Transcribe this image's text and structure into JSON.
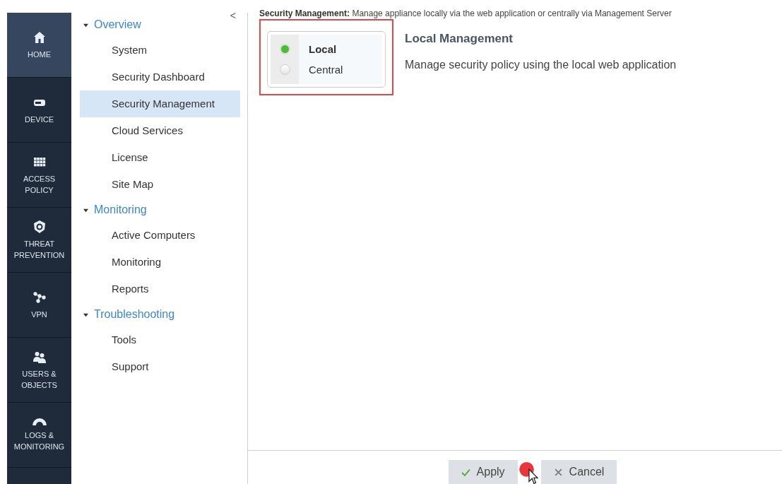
{
  "sidebar": {
    "items": [
      {
        "kind": "home",
        "label": "HOME",
        "selected": true
      },
      {
        "kind": "device",
        "label": "DEVICE",
        "selected": false
      },
      {
        "kind": "grid",
        "label": "ACCESS POLICY",
        "selected": false
      },
      {
        "kind": "shield",
        "label": "THREAT PREVENTION",
        "selected": false
      },
      {
        "kind": "nodes",
        "label": "VPN",
        "selected": false
      },
      {
        "kind": "users",
        "label": "USERS & OBJECTS",
        "selected": false
      },
      {
        "kind": "gauge",
        "label": "LOGS & MONITORING",
        "selected": false
      }
    ]
  },
  "nav": {
    "collapse": "<",
    "sections": [
      {
        "label": "Overview",
        "expanded": true,
        "children": [
          {
            "label": "System",
            "selected": false
          },
          {
            "label": "Security Dashboard",
            "selected": false
          },
          {
            "label": "Security Management",
            "selected": true
          },
          {
            "label": "Cloud Services",
            "selected": false
          },
          {
            "label": "License",
            "selected": false
          },
          {
            "label": "Site Map",
            "selected": false
          }
        ]
      },
      {
        "label": "Monitoring",
        "expanded": true,
        "children": [
          {
            "label": "Active Computers",
            "selected": false
          },
          {
            "label": "Monitoring",
            "selected": false
          },
          {
            "label": "Reports",
            "selected": false
          }
        ]
      },
      {
        "label": "Troubleshooting",
        "expanded": true,
        "children": [
          {
            "label": "Tools",
            "selected": false
          },
          {
            "label": "Support",
            "selected": false
          }
        ]
      }
    ]
  },
  "content": {
    "header": "**Security Management:** Manage appliance locally via the web application or centrally via Management Server",
    "options": [
      {
        "label": "Local",
        "selected": true
      },
      {
        "label": "Central",
        "selected": false
      }
    ],
    "detail_title": "Local Management",
    "detail_text": "Manage security policy using the local web application"
  },
  "footer": {
    "buttons": [
      {
        "kind": "apply",
        "label": "Apply"
      },
      {
        "kind": "cancel",
        "label": "Cancel"
      }
    ]
  }
}
